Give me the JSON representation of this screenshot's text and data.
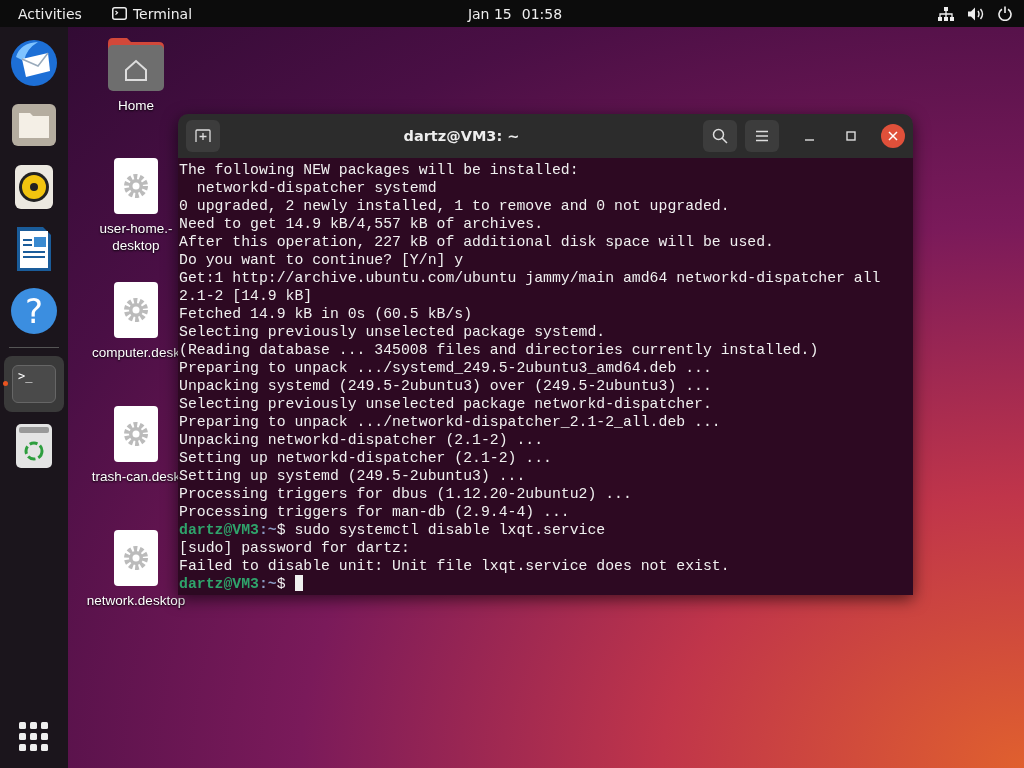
{
  "top_bar": {
    "activities": "Activities",
    "app_name": "Terminal",
    "date": "Jan 15",
    "time": "01:58"
  },
  "dock": {
    "items": [
      {
        "kind": "mail",
        "selected": false,
        "running": false
      },
      {
        "kind": "files",
        "selected": false,
        "running": false
      },
      {
        "kind": "music",
        "selected": false,
        "running": false
      },
      {
        "kind": "writer",
        "selected": false,
        "running": false
      },
      {
        "kind": "help",
        "glyph": "?",
        "selected": false,
        "running": false
      },
      {
        "kind": "terminal",
        "glyph": ">_",
        "selected": true,
        "running": true
      },
      {
        "kind": "trash",
        "selected": false,
        "running": false
      }
    ]
  },
  "desktop_icons": [
    {
      "kind": "home",
      "lines": [
        "Home"
      ]
    },
    {
      "kind": "launcher",
      "lines": [
        "user-home.-",
        "desktop"
      ]
    },
    {
      "kind": "launcher",
      "lines": [
        "computer.desk"
      ]
    },
    {
      "kind": "launcher",
      "lines": [
        "trash-can.desk"
      ]
    },
    {
      "kind": "launcher",
      "lines": [
        "network.desktop"
      ]
    }
  ],
  "terminal": {
    "title": "dartz@VM3: ~",
    "lines": [
      {
        "kind": "output",
        "text": "The following NEW packages will be installed:"
      },
      {
        "kind": "output",
        "text": "  networkd-dispatcher systemd"
      },
      {
        "kind": "output",
        "text": "0 upgraded, 2 newly installed, 1 to remove and 0 not upgraded."
      },
      {
        "kind": "output",
        "text": "Need to get 14.9 kB/4,557 kB of archives."
      },
      {
        "kind": "output",
        "text": "After this operation, 227 kB of additional disk space will be used."
      },
      {
        "kind": "output",
        "text": "Do you want to continue? [Y/n] y"
      },
      {
        "kind": "output",
        "text": "Get:1 http://archive.ubuntu.com/ubuntu jammy/main amd64 networkd-dispatcher all"
      },
      {
        "kind": "output",
        "text": "2.1-2 [14.9 kB]"
      },
      {
        "kind": "output",
        "text": "Fetched 14.9 kB in 0s (60.5 kB/s)"
      },
      {
        "kind": "output",
        "text": "Selecting previously unselected package systemd."
      },
      {
        "kind": "output",
        "text": "(Reading database ... 345008 files and directories currently installed.)"
      },
      {
        "kind": "output",
        "text": "Preparing to unpack .../systemd_249.5-2ubuntu3_amd64.deb ..."
      },
      {
        "kind": "output",
        "text": "Unpacking systemd (249.5-2ubuntu3) over (249.5-2ubuntu3) ..."
      },
      {
        "kind": "output",
        "text": "Selecting previously unselected package networkd-dispatcher."
      },
      {
        "kind": "output",
        "text": "Preparing to unpack .../networkd-dispatcher_2.1-2_all.deb ..."
      },
      {
        "kind": "output",
        "text": "Unpacking networkd-dispatcher (2.1-2) ..."
      },
      {
        "kind": "output",
        "text": "Setting up networkd-dispatcher (2.1-2) ..."
      },
      {
        "kind": "output",
        "text": "Setting up systemd (249.5-2ubuntu3) ..."
      },
      {
        "kind": "output",
        "text": "Processing triggers for dbus (1.12.20-2ubuntu2) ..."
      },
      {
        "kind": "output",
        "text": "Processing triggers for man-db (2.9.4-4) ..."
      },
      {
        "kind": "prompt",
        "user": "dartz@VM3",
        "path": ":~",
        "command": "$ sudo systemctl disable lxqt.service"
      },
      {
        "kind": "output",
        "text": "[sudo] password for dartz:"
      },
      {
        "kind": "output",
        "text": "Failed to disable unit: Unit file lxqt.service does not exist."
      },
      {
        "kind": "prompt",
        "user": "dartz@VM3",
        "path": ":~",
        "command": "$",
        "cursor": true
      }
    ]
  }
}
